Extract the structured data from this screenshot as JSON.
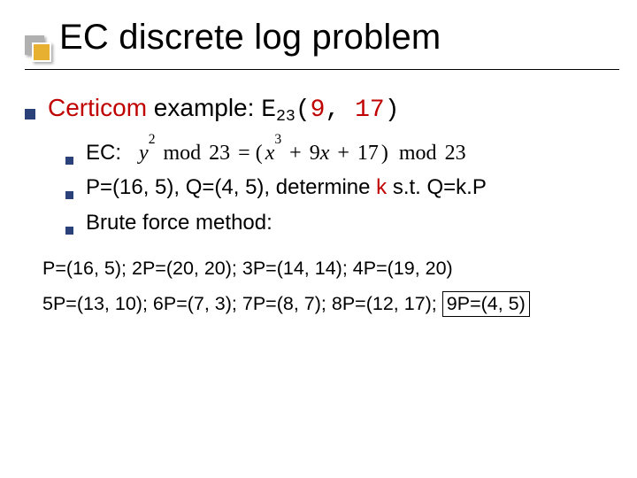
{
  "title": "EC discrete log problem",
  "main": {
    "lead_text": "Certicom",
    "lead_rest": " example: ",
    "curve_E": "E",
    "curve_sub": "23",
    "curve_paren_open": "(",
    "curve_a": "9",
    "curve_comma": ", ",
    "curve_b": "17",
    "curve_paren_close": ")"
  },
  "sub": {
    "ec_label": "EC:",
    "formula_raw": "y² mod 23 = (x³ + 9x + 17) mod 23",
    "pq_pre": "P=(16, 5), Q=(4, 5), determine ",
    "pq_k": "k",
    "pq_post": " s.t. Q=k.P",
    "brute": "Brute force method:"
  },
  "brute_lines": {
    "l1": "P=(16, 5);  2P=(20, 20);  3P=(14, 14);  4P=(19, 20)",
    "l2a": "5P=(13, 10);  6P=(7, 3);  7P=(8, 7);  8P=(12, 17); ",
    "l2_box": "9P=(4, 5)"
  }
}
